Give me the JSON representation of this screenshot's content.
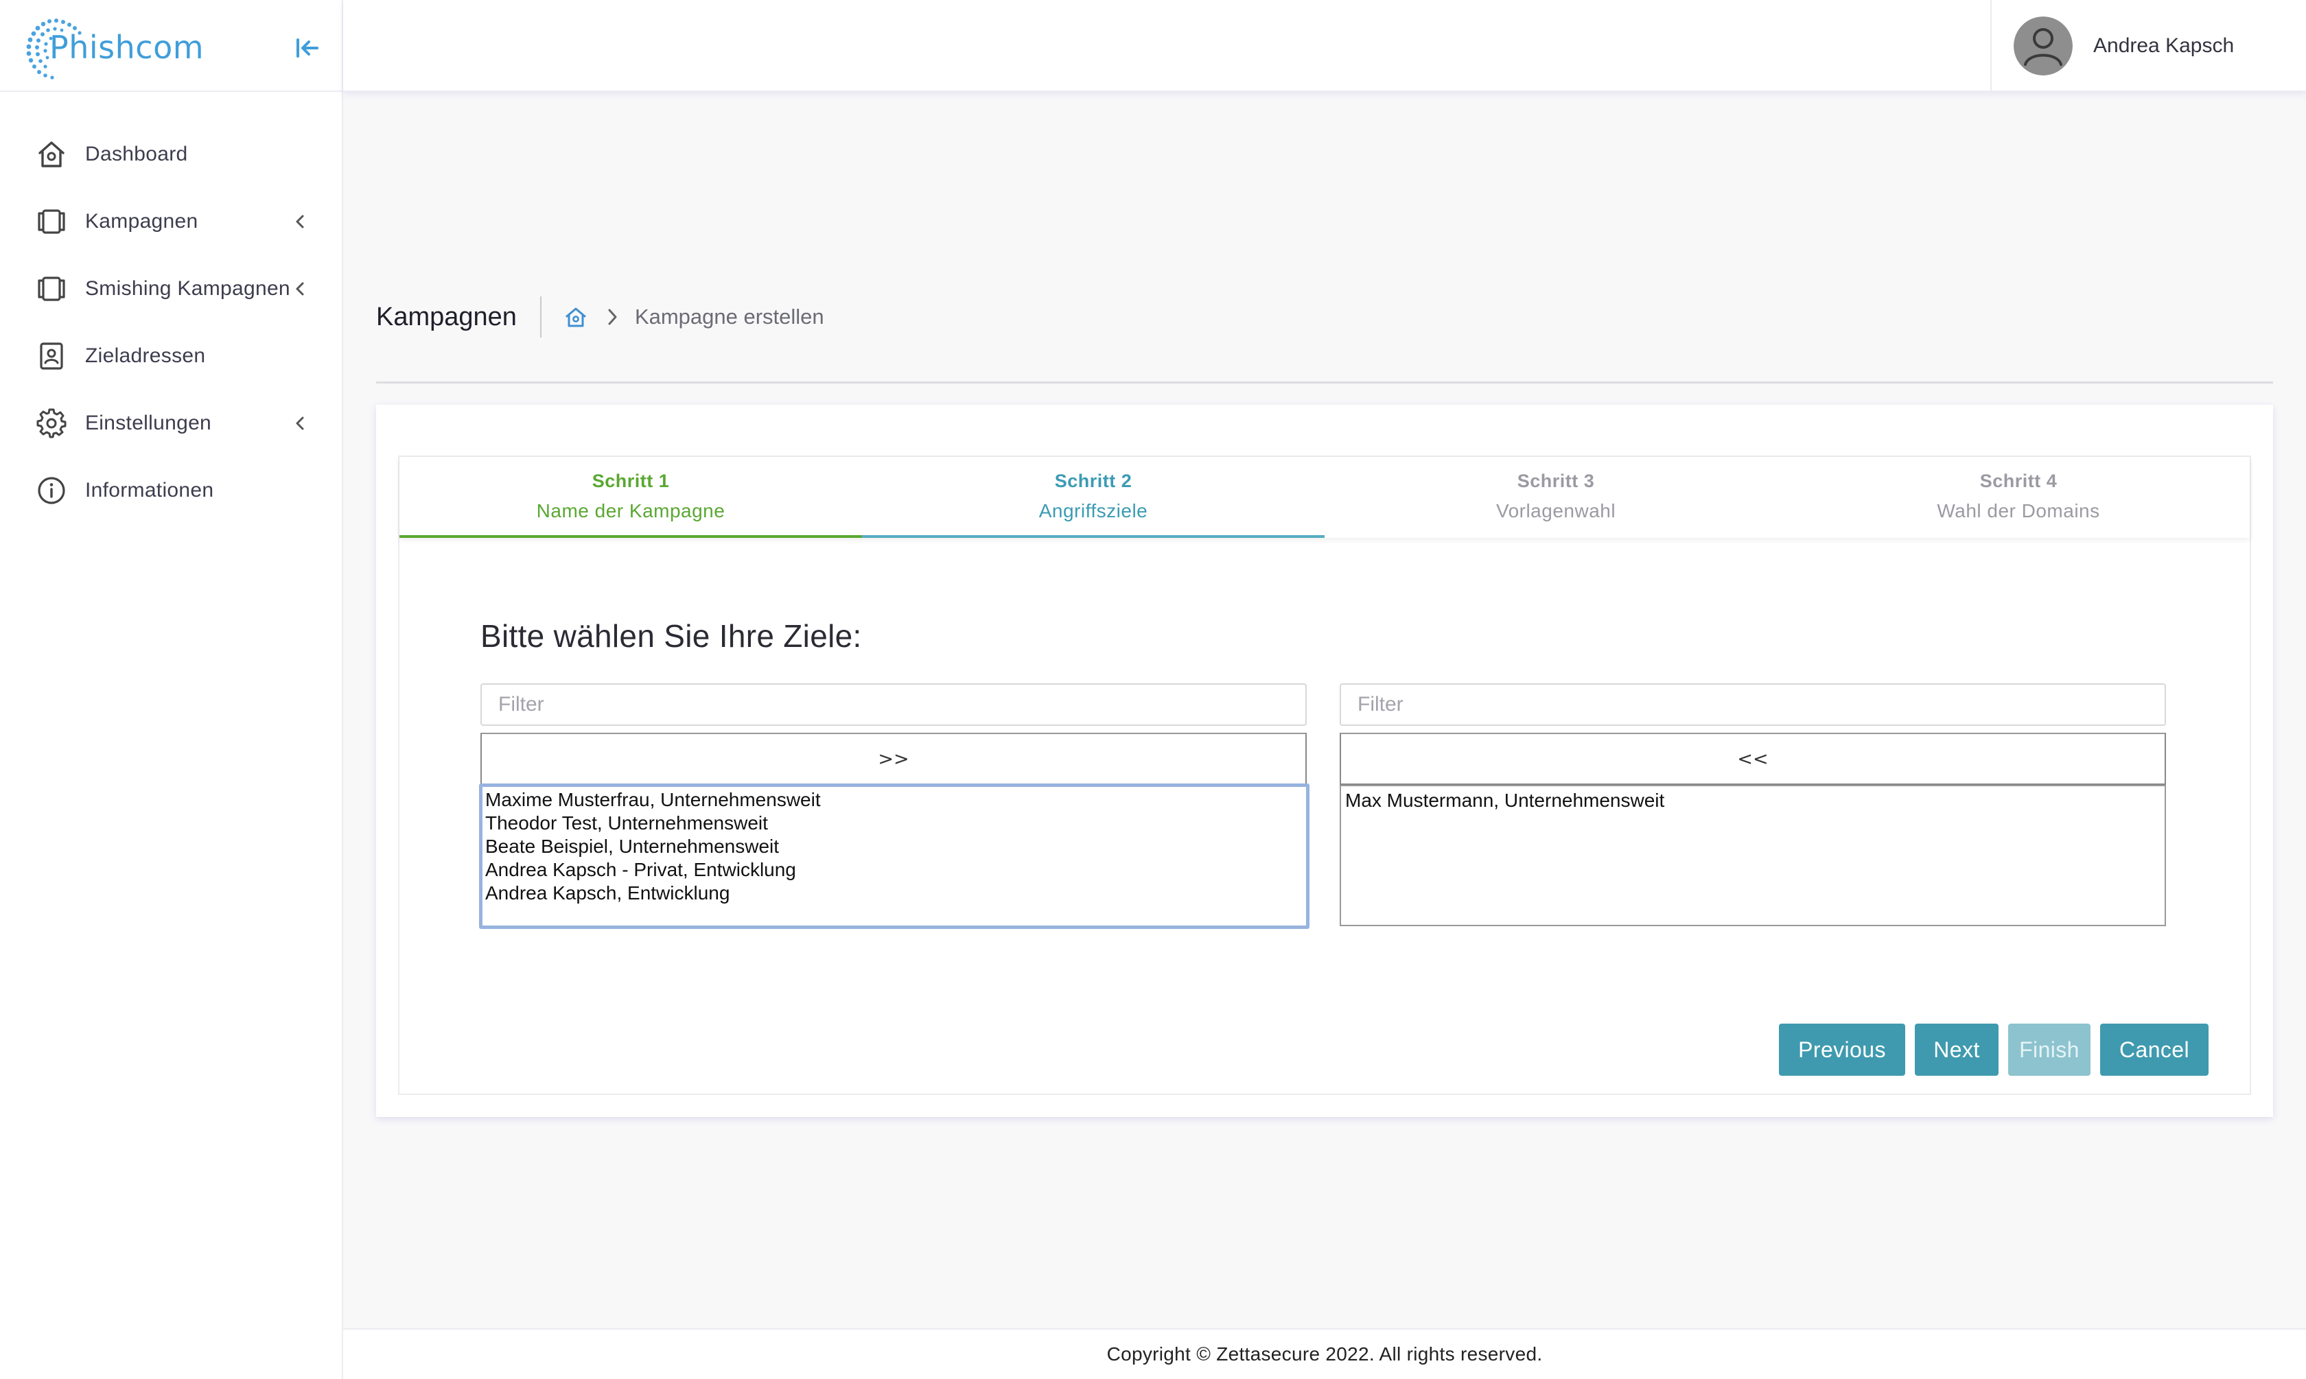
{
  "brand": {
    "name": "Phishcom",
    "accent": "#3f9ed9"
  },
  "sidebar": {
    "items": [
      {
        "label": "Dashboard",
        "icon": "home-icon",
        "has_submenu": false
      },
      {
        "label": "Kampagnen",
        "icon": "campaigns-icon",
        "has_submenu": true
      },
      {
        "label": "Smishing Kampagnen",
        "icon": "campaigns-icon",
        "has_submenu": true
      },
      {
        "label": "Zieladressen",
        "icon": "contact-card-icon",
        "has_submenu": false
      },
      {
        "label": "Einstellungen",
        "icon": "gear-icon",
        "has_submenu": true
      },
      {
        "label": "Informationen",
        "icon": "info-icon",
        "has_submenu": false
      }
    ]
  },
  "header": {
    "user_name": "Andrea Kapsch"
  },
  "breadcrumb": {
    "title": "Kampagnen",
    "current": "Kampagne erstellen"
  },
  "wizard": {
    "steps": [
      {
        "label": "Schritt 1",
        "description": "Name der Kampagne",
        "state": "done"
      },
      {
        "label": "Schritt 2",
        "description": "Angriffsziele",
        "state": "active"
      },
      {
        "label": "Schritt 3",
        "description": "Vorlagenwahl",
        "state": "todo"
      },
      {
        "label": "Schritt 4",
        "description": "Wahl der Domains",
        "state": "todo"
      }
    ],
    "question": "Bitte wählen Sie Ihre Ziele:",
    "left": {
      "filter_placeholder": "Filter",
      "move_label": ">>",
      "options": [
        "Maxime Musterfrau, Unternehmensweit",
        "Theodor Test, Unternehmensweit",
        "Beate Beispiel, Unternehmensweit",
        "Andrea Kapsch - Privat, Entwicklung",
        "Andrea Kapsch, Entwicklung"
      ]
    },
    "right": {
      "filter_placeholder": "Filter",
      "move_label": "<<",
      "options": [
        "Max Mustermann, Unternehmensweit"
      ]
    },
    "buttons": {
      "previous": "Previous",
      "next": "Next",
      "finish": "Finish",
      "finish_disabled": true,
      "cancel": "Cancel"
    },
    "colors": {
      "done": "#5aa832",
      "active": "#3b9bb4",
      "button": "#3f9aaf"
    }
  },
  "footer": {
    "text": "Copyright © Zettasecure 2022. All rights reserved."
  }
}
